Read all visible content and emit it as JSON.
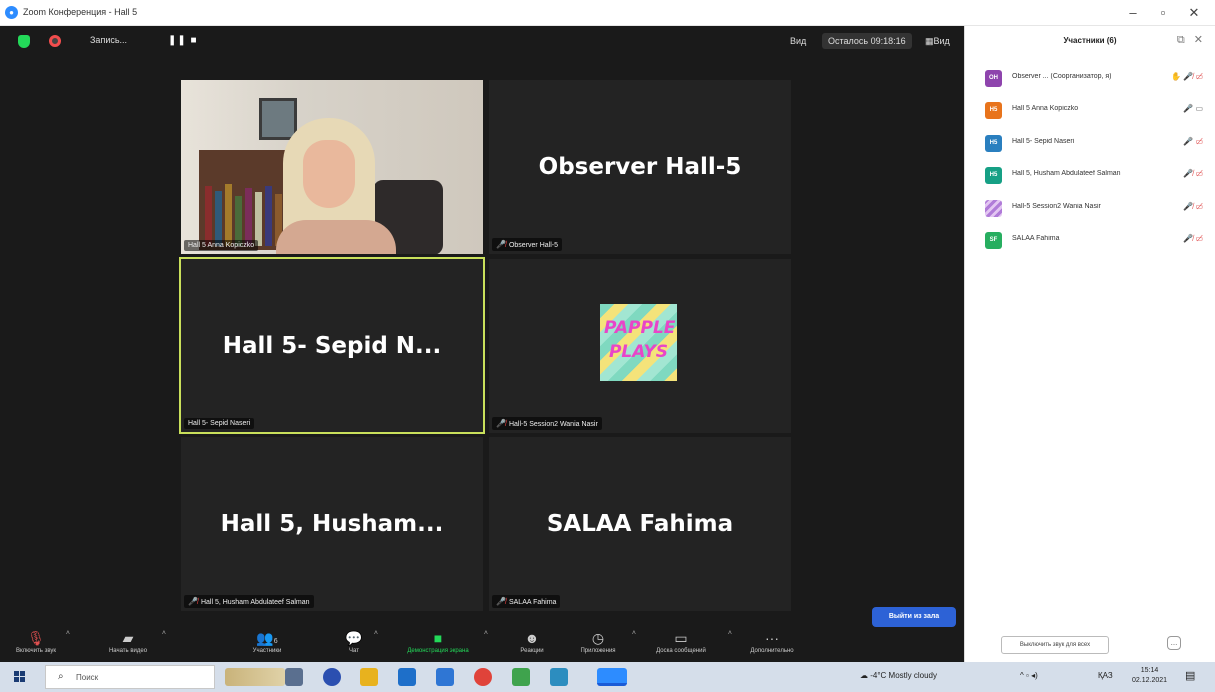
{
  "window": {
    "title": "Zoom Конференция - Hall 5"
  },
  "topbar": {
    "recording_label": "Запись...",
    "view_label": "Вид",
    "timer_label": "Осталось 09:18:16",
    "grid_label": "Вид"
  },
  "tiles": [
    {
      "display_name": "",
      "tag": "Hall 5 Anna Kopiczko",
      "muted": false,
      "has_video": true
    },
    {
      "display_name": "Observer  Hall-5",
      "tag": "Observer Hall-5",
      "muted": true
    },
    {
      "display_name": "Hall 5- Sepid N...",
      "tag": "Hall 5- Sepid Naseri",
      "muted": false,
      "active": true
    },
    {
      "display_name": "",
      "tag": "Hall-5 Session2 Wania Nasir",
      "muted": true,
      "avatar_text": "PAPPLE PLAYS"
    },
    {
      "display_name": "Hall 5, Husham...",
      "tag": "Hall 5, Husham Abdulateef Salman",
      "muted": true
    },
    {
      "display_name": "SALAA Fahima",
      "tag": "SALAA Fahima",
      "muted": true
    }
  ],
  "toolbar": {
    "audio": "Включить звук",
    "video": "Начать видео",
    "participants": "Участники",
    "participants_count": "6",
    "chat": "Чат",
    "share": "Демонстрация экрана",
    "reactions": "Реакции",
    "apps": "Приложения",
    "whiteboard": "Доска сообщений",
    "more": "Дополнительно",
    "leave": "Выйти из зала"
  },
  "panel": {
    "title": "Участники (6)",
    "participants": [
      {
        "initials": "OH",
        "name": "Observer ... (Соорганизатор, я)",
        "color": "#8e44ad"
      },
      {
        "initials": "H5",
        "name": "Hall 5 Anna Kopiczko",
        "color": "#e8741c"
      },
      {
        "initials": "H5",
        "name": "Hall 5- Sepid Naseri",
        "color": "#2a7fbf"
      },
      {
        "initials": "H5",
        "name": "Hall 5, Husham Abdulateef Salman",
        "color": "#16a085"
      },
      {
        "initials": "",
        "name": "Hall-5 Session2 Wania Nasir",
        "color": "#b07bd8"
      },
      {
        "initials": "SF",
        "name": "SALAA Fahima",
        "color": "#27ae60"
      }
    ],
    "mute_all": "Выключить звук для всех",
    "more": "..."
  },
  "taskbar": {
    "search_placeholder": "Поиск",
    "weather": "-4°C  Mostly cloudy",
    "lang": "ҚАЗ",
    "time": "15:14",
    "date": "02.12.2021"
  }
}
